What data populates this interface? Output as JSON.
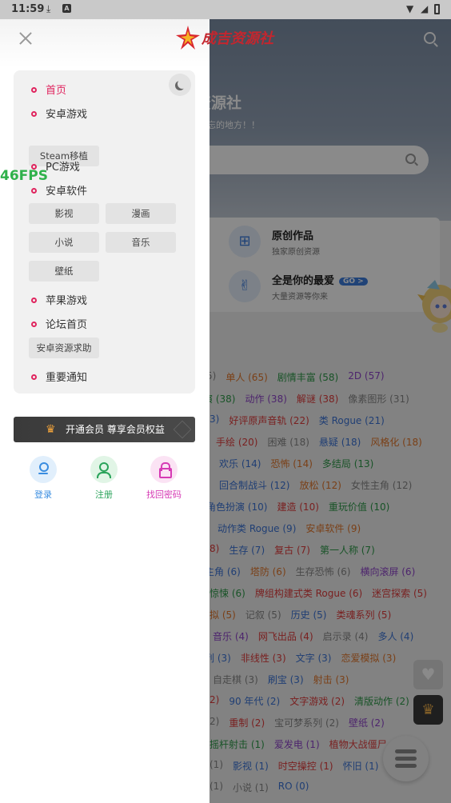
{
  "status_bar": {
    "time": "11:59"
  },
  "site": {
    "logo_text": "成吉资源社",
    "hero_title": "言资源社",
    "hero_subtitle": "久不能忘的地方！！"
  },
  "features": [
    {
      "title": "原创作品",
      "subtitle": "独家原创资源"
    },
    {
      "title": "全是你的最爱",
      "badge": "GO >",
      "subtitle": "大量资源等你来"
    }
  ],
  "tags": [
    {
      "label": "5)",
      "color": "gray"
    },
    {
      "label": "单人 (65)",
      "color": "orange"
    },
    {
      "label": "剧情丰富 (58)",
      "color": "green"
    },
    {
      "label": "2D (57)",
      "color": "purple"
    },
    {
      "label": "演 (38)",
      "color": "green"
    },
    {
      "label": "动作 (38)",
      "color": "purple"
    },
    {
      "label": "解谜 (38)",
      "color": "red"
    },
    {
      "label": "像素图形 (31)",
      "color": "gray"
    },
    {
      "label": "3)",
      "color": "blue"
    },
    {
      "label": "好评原声音轨 (22)",
      "color": "red"
    },
    {
      "label": "类 Rogue (21)",
      "color": "blue"
    },
    {
      "label": "手绘 (20)",
      "color": "red"
    },
    {
      "label": "困难 (18)",
      "color": "gray"
    },
    {
      "label": "悬疑 (18)",
      "color": "blue"
    },
    {
      "label": "风格化 (18)",
      "color": "orange"
    },
    {
      "label": "欢乐 (14)",
      "color": "blue"
    },
    {
      "label": "恐怖 (14)",
      "color": "orange"
    },
    {
      "label": "多结局 (13)",
      "color": "green"
    },
    {
      "label": "回合制战斗 (12)",
      "color": "blue"
    },
    {
      "label": "放松 (12)",
      "color": "orange"
    },
    {
      "label": "女性主角 (12)",
      "color": "gray"
    },
    {
      "label": "角色扮演 (10)",
      "color": "blue"
    },
    {
      "label": "建造 (10)",
      "color": "red"
    },
    {
      "label": "重玩价值 (10)",
      "color": "green"
    },
    {
      "label": "动作类 Rogue (9)",
      "color": "blue"
    },
    {
      "label": "安卓软件 (9)",
      "color": "orange"
    },
    {
      "label": "8)",
      "color": "red"
    },
    {
      "label": "生存 (7)",
      "color": "blue"
    },
    {
      "label": "复古 (7)",
      "color": "red"
    },
    {
      "label": "第一人称 (7)",
      "color": "green"
    },
    {
      "label": "主角 (6)",
      "color": "blue"
    },
    {
      "label": "塔防 (6)",
      "color": "orange"
    },
    {
      "label": "生存恐怖 (6)",
      "color": "gray"
    },
    {
      "label": "横向滚屏 (6)",
      "color": "purple"
    },
    {
      "label": "惊悚 (6)",
      "color": "green"
    },
    {
      "label": "牌组构建式类 Rogue (6)",
      "color": "red"
    },
    {
      "label": "迷宫探索 (5)",
      "color": "red"
    },
    {
      "label": "拟 (5)",
      "color": "orange"
    },
    {
      "label": "记叙 (5)",
      "color": "gray"
    },
    {
      "label": "历史 (5)",
      "color": "blue"
    },
    {
      "label": "类魂系列 (5)",
      "color": "red"
    },
    {
      "label": "音乐 (4)",
      "color": "purple"
    },
    {
      "label": "网飞出品 (4)",
      "color": "red"
    },
    {
      "label": "启示录 (4)",
      "color": "gray"
    },
    {
      "label": "多人 (4)",
      "color": "blue"
    },
    {
      "label": "列 (3)",
      "color": "blue"
    },
    {
      "label": "非线性 (3)",
      "color": "red"
    },
    {
      "label": "文字 (3)",
      "color": "blue"
    },
    {
      "label": "恋爱模拟 (3)",
      "color": "orange"
    },
    {
      "label": "自走棋 (3)",
      "color": "gray"
    },
    {
      "label": "刷宝 (3)",
      "color": "blue"
    },
    {
      "label": "射击 (3)",
      "color": "orange"
    },
    {
      "label": "2)",
      "color": "red"
    },
    {
      "label": "90 年代 (2)",
      "color": "blue"
    },
    {
      "label": "文字游戏 (2)",
      "color": "red"
    },
    {
      "label": "清版动作 (2)",
      "color": "green"
    },
    {
      "label": "2)",
      "color": "gray"
    },
    {
      "label": "重制 (2)",
      "color": "red"
    },
    {
      "label": "宝可梦系列 (2)",
      "color": "gray"
    },
    {
      "label": "壁纸 (2)",
      "color": "purple"
    },
    {
      "label": "摇杆射击 (1)",
      "color": "green"
    },
    {
      "label": "爱发电 (1)",
      "color": "purple"
    },
    {
      "label": "植物大战僵尸",
      "color": "red"
    },
    {
      "label": "(1)",
      "color": "gray"
    },
    {
      "label": "影视 (1)",
      "color": "blue"
    },
    {
      "label": "时空操控 (1)",
      "color": "red"
    },
    {
      "label": "怀旧 (1)",
      "color": "blue"
    },
    {
      "label": "(1)",
      "color": "gray"
    },
    {
      "label": "小说 (1)",
      "color": "gray"
    },
    {
      "label": "RO (0)",
      "color": "blue"
    }
  ],
  "drawer": {
    "menu": [
      {
        "label": "首页",
        "active": true
      },
      {
        "label": "安卓游戏"
      },
      {
        "label": "PC游戏"
      },
      {
        "label": "安卓软件"
      },
      {
        "label": "苹果游戏"
      },
      {
        "label": "论坛首页"
      },
      {
        "label": "重要通知"
      }
    ],
    "sub_steam": "Steam移植",
    "sub_soft": [
      "影视",
      "漫画",
      "小说",
      "音乐",
      "壁纸"
    ],
    "sub_forum": "安卓资源求助",
    "vip": "开通会员 尊享会员权益",
    "account": [
      "登录",
      "注册",
      "找回密码"
    ]
  },
  "fps": "46FPS",
  "colors": {
    "accent": "#e0245e",
    "login": "#3a8de0",
    "register": "#2aa35a",
    "recover": "#d63ab4",
    "red": "#e03b3b",
    "blue": "#3b74d6",
    "green": "#2d9a48",
    "orange": "#e2762b",
    "gray": "#888888",
    "purple": "#8e44c9"
  }
}
